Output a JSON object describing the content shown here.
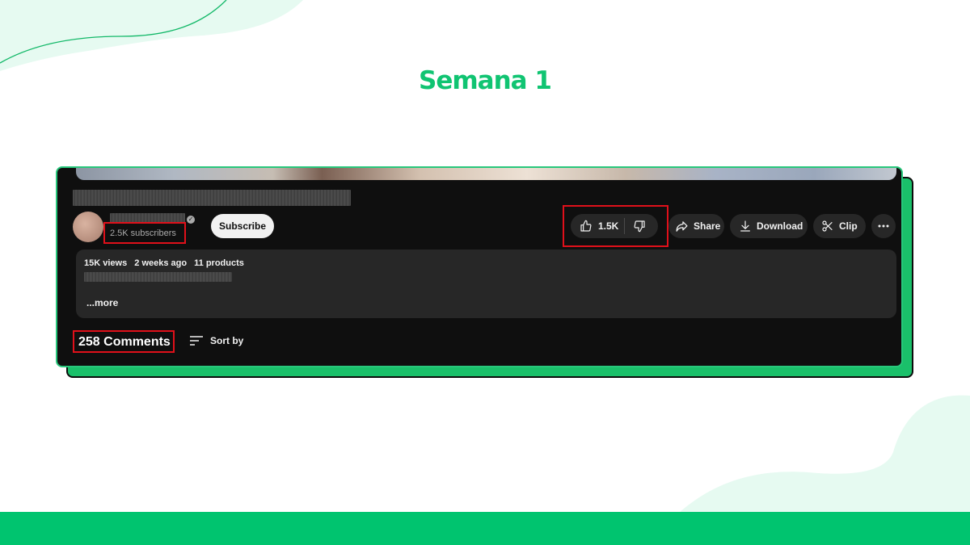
{
  "slide": {
    "title": "Semana 1",
    "accent_color": "#10c472",
    "footer_bar_color": "#00c46f"
  },
  "video": {
    "channel": {
      "subscribers": "2.5K subscribers",
      "verified_icon": "verified-check-icon",
      "subscribe_label": "Subscribe"
    },
    "actions": {
      "like_count": "1.5K",
      "like_icon": "thumbs-up-icon",
      "dislike_icon": "thumbs-down-icon",
      "share_label": "Share",
      "download_label": "Download",
      "clip_label": "Clip",
      "more_icon": "more-horizontal-icon"
    },
    "description": {
      "views": "15K views",
      "age": "2 weeks ago",
      "products": "11 products",
      "more_label": "...more"
    },
    "comments": {
      "count_label": "258 Comments",
      "sort_label": "Sort by"
    },
    "highlight_color": "#e0101a"
  }
}
